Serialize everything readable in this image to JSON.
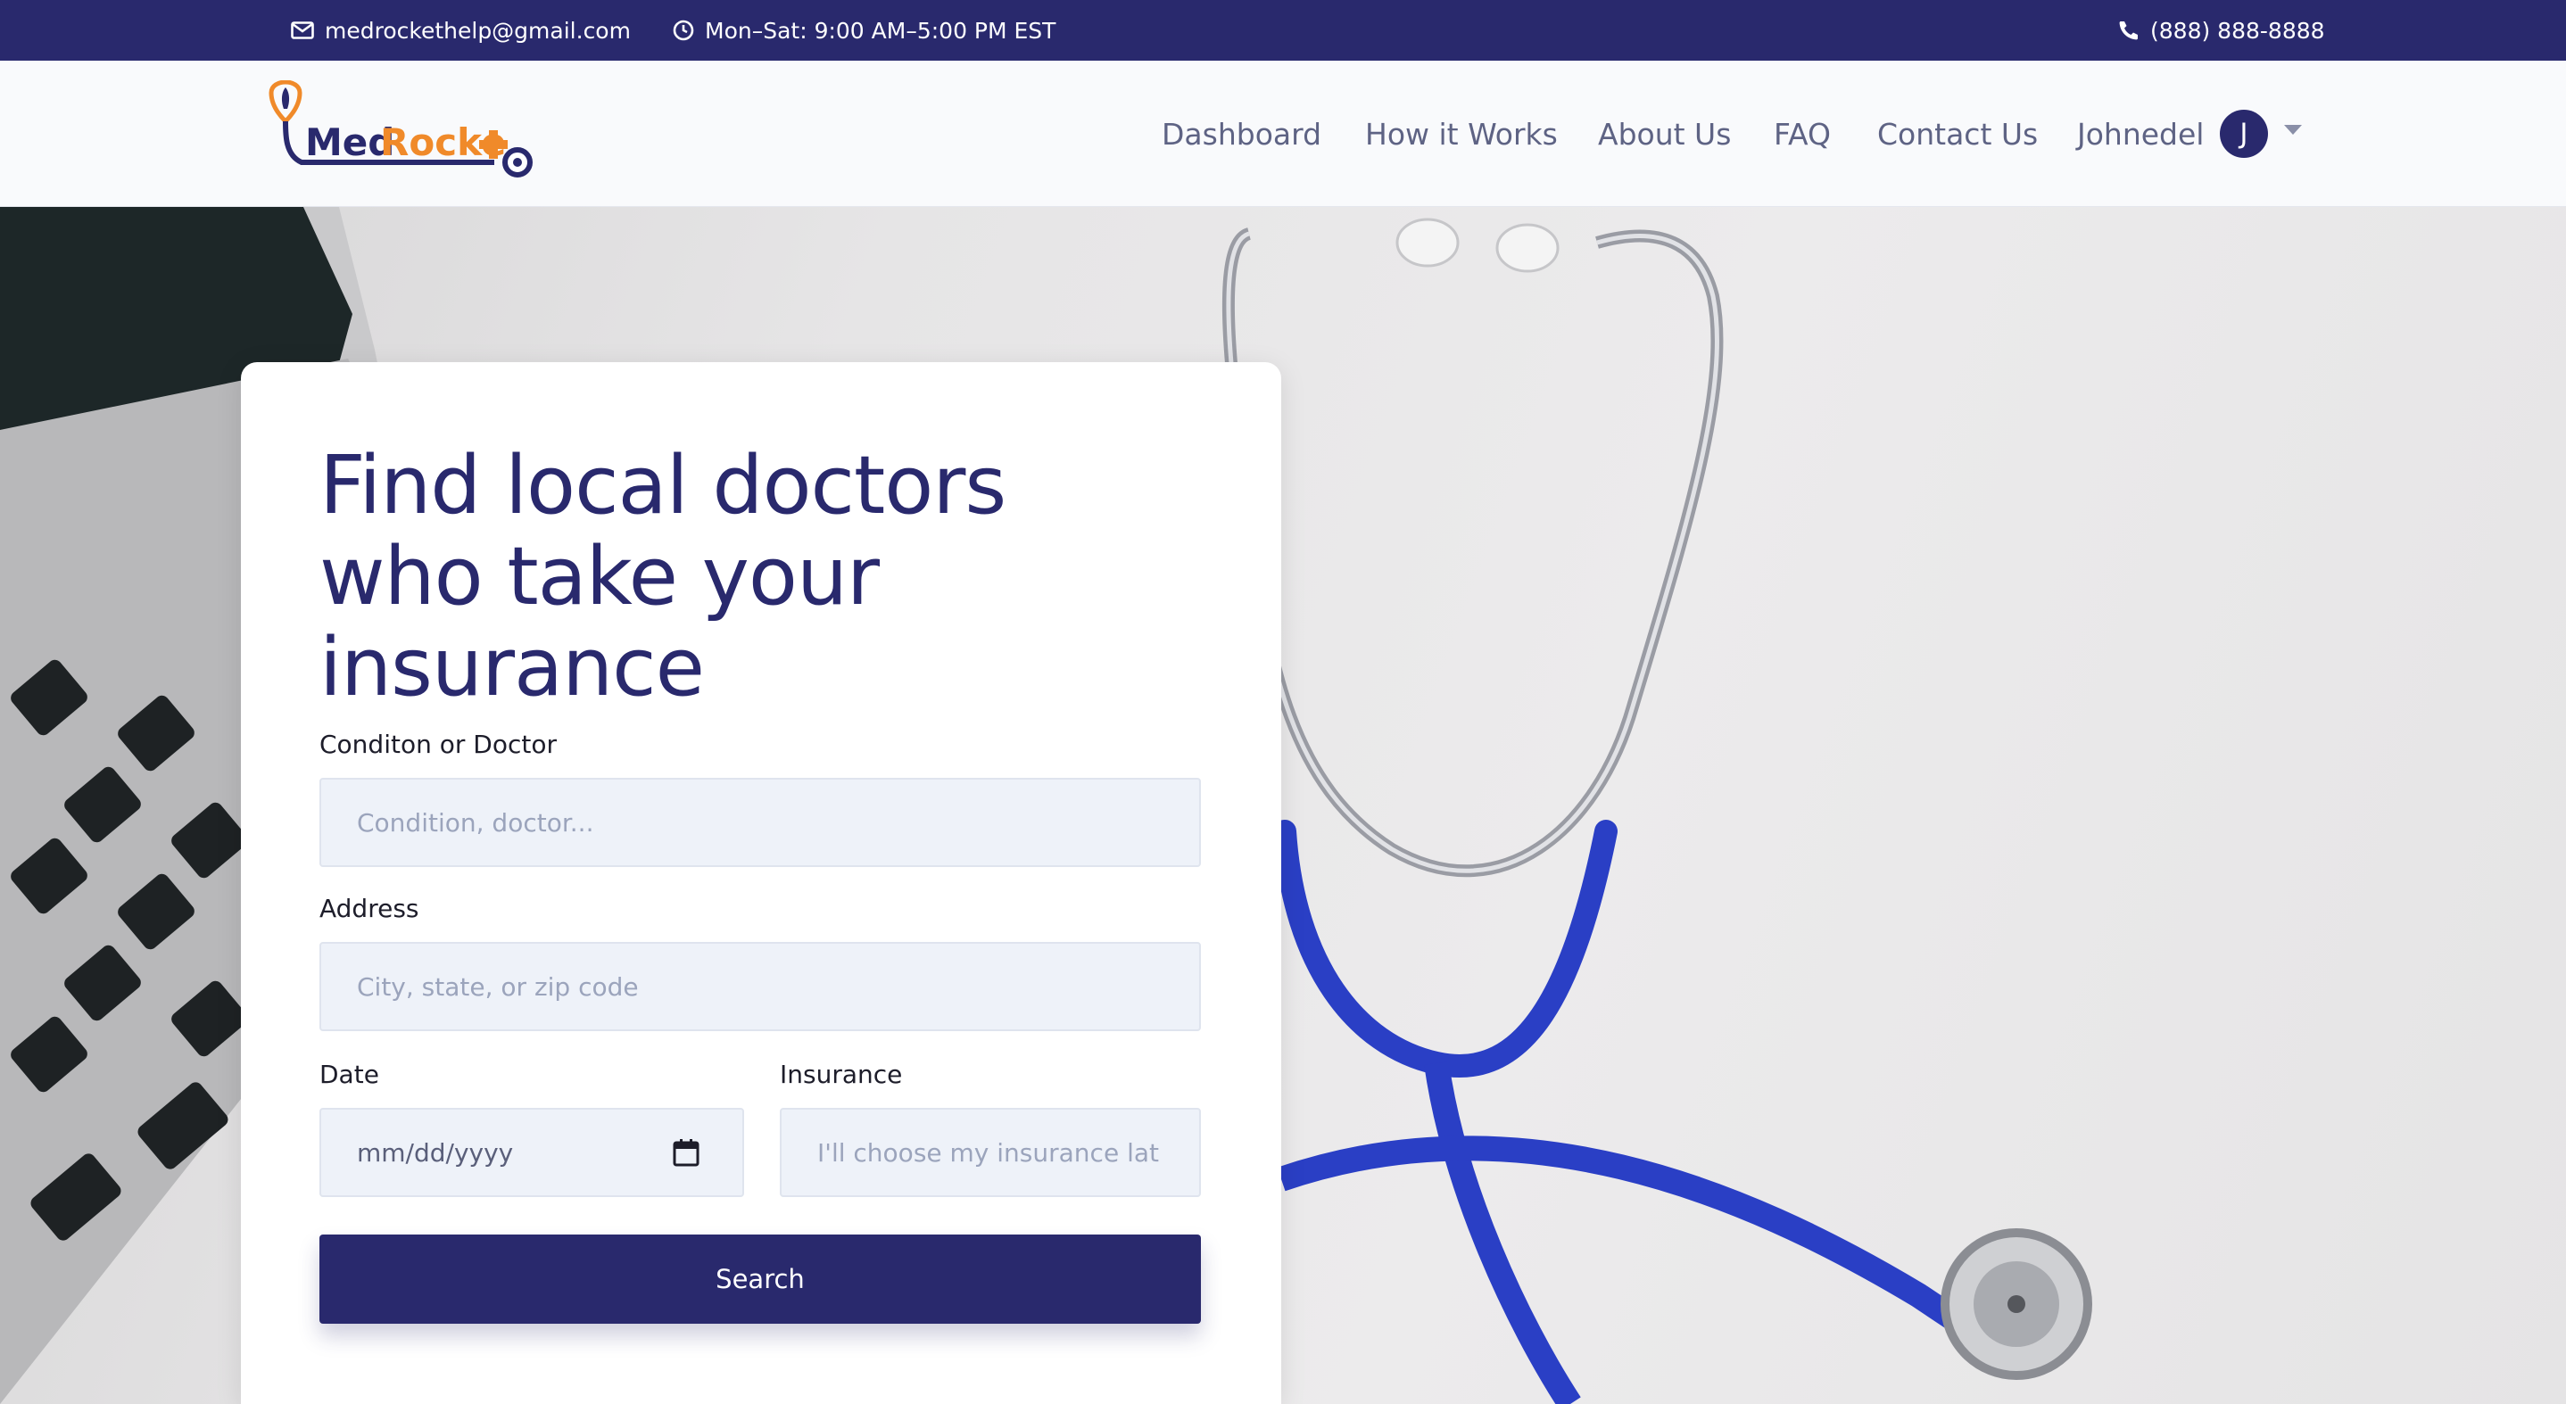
{
  "topbar": {
    "email": "medrockethelp@gmail.com",
    "hours": "Mon–Sat: 9:00 AM–5:00 PM EST",
    "phone": "(888) 888-8888"
  },
  "logo": {
    "text_part1": "Med",
    "text_part2": "Rocke"
  },
  "nav": {
    "items": [
      {
        "label": "Dashboard"
      },
      {
        "label": "How it Works"
      },
      {
        "label": "About Us"
      },
      {
        "label": "FAQ"
      },
      {
        "label": "Contact Us"
      }
    ],
    "user": {
      "name": "Johnedel",
      "initial": "J"
    }
  },
  "search_card": {
    "headline_lines": [
      "Find local doctors",
      "who take your",
      "insurance"
    ],
    "condition": {
      "label": "Conditon or Doctor",
      "placeholder": "Condition, doctor..."
    },
    "address": {
      "label": "Address",
      "placeholder": "City, state, or zip code"
    },
    "date": {
      "label": "Date",
      "value": "mm/dd/yyyy"
    },
    "insurance": {
      "label": "Insurance",
      "placeholder": "I'll choose my insurance lat"
    },
    "search_label": "Search"
  },
  "colors": {
    "brand_navy": "#29296d",
    "brand_orange": "#f08a2a",
    "input_bg": "#eef2f9"
  },
  "icons": {
    "email": "envelope-icon",
    "hours": "clock-icon",
    "phone": "phone-icon",
    "date": "calendar-icon"
  }
}
